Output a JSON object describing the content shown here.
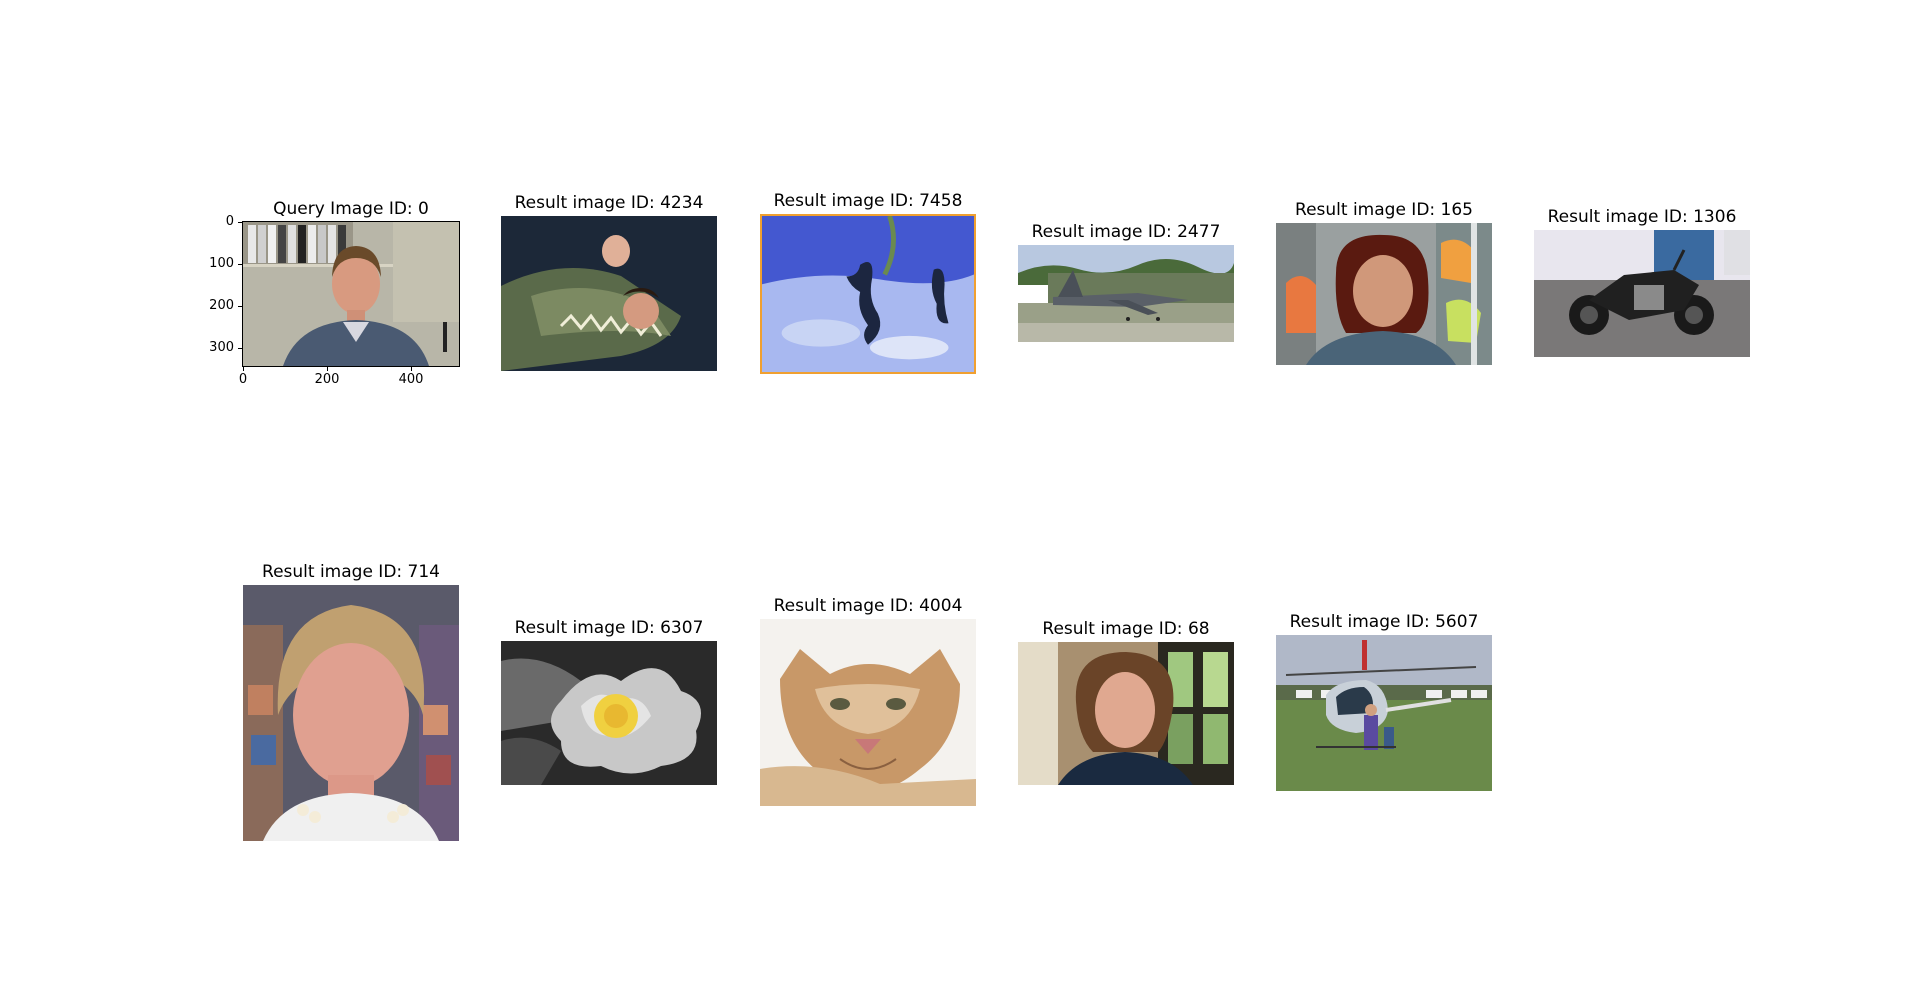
{
  "query": {
    "title": "Query Image ID: 0",
    "y_ticks": [
      "0",
      "100",
      "200",
      "300"
    ],
    "x_ticks": [
      "0",
      "200",
      "400"
    ],
    "image": "man-at-office-photo"
  },
  "results_row1": [
    {
      "title": "Result image ID: 4234",
      "image": "man-in-crocodile-jaws-photo"
    },
    {
      "title": "Result image ID: 7458",
      "image": "seahorses-photo"
    },
    {
      "title": "Result image ID: 2477",
      "image": "fighter-jet-photo"
    },
    {
      "title": "Result image ID: 165",
      "image": "woman-portrait-photo"
    },
    {
      "title": "Result image ID: 1306",
      "image": "motorcycle-photo"
    }
  ],
  "results_row2": [
    {
      "title": "Result image ID: 714",
      "image": "woman-with-pearls-photo"
    },
    {
      "title": "Result image ID: 6307",
      "image": "yellow-flower-photo"
    },
    {
      "title": "Result image ID: 4004",
      "image": "cougar-drawing"
    },
    {
      "title": "Result image ID: 68",
      "image": "woman-brown-hair-photo"
    },
    {
      "title": "Result image ID: 5607",
      "image": "helicopter-photo"
    }
  ],
  "colors": {
    "highlight_border": "#f0a030"
  }
}
